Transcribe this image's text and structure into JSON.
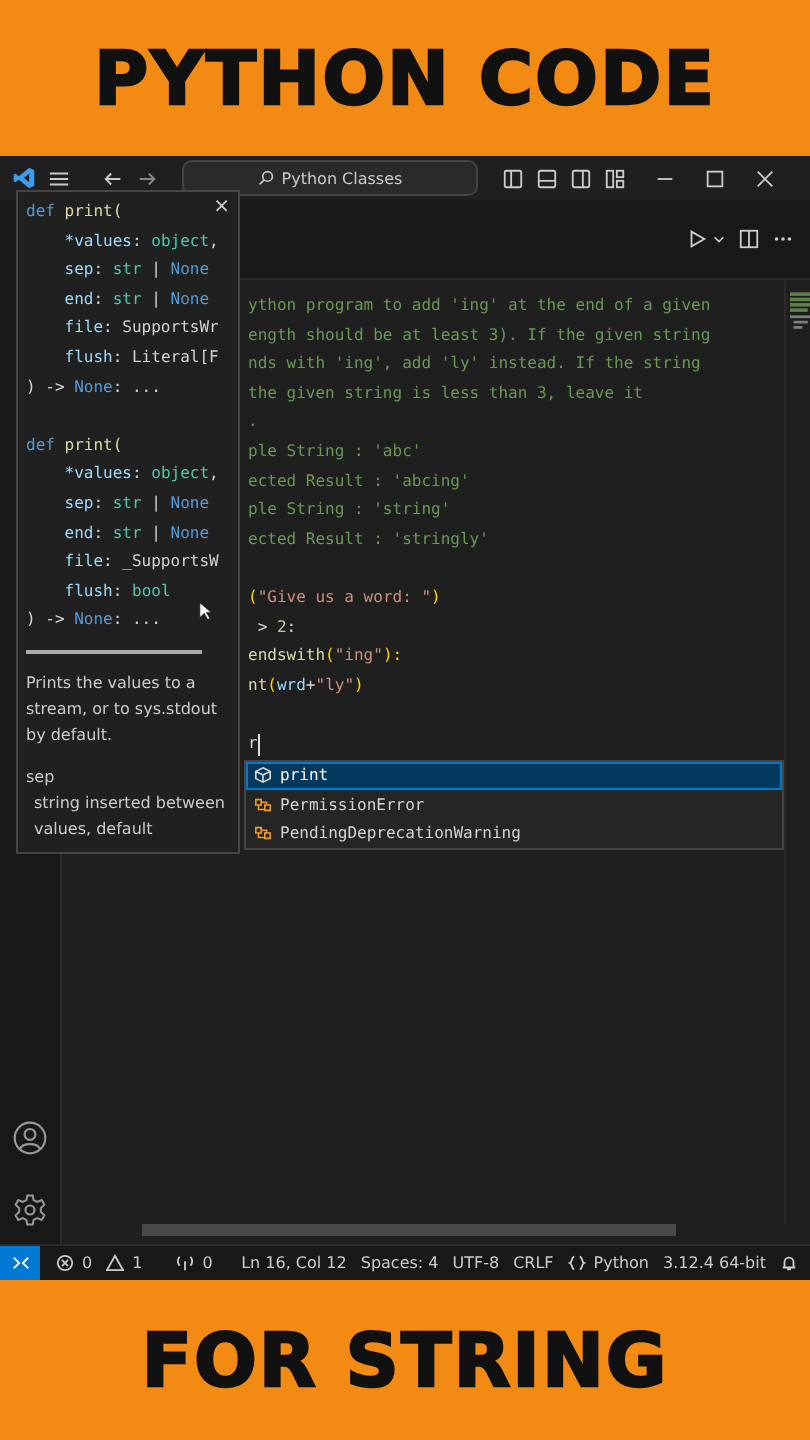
{
  "banner_top": "PYTHON CODE",
  "title_bar": {
    "search": "Python Classes"
  },
  "hover": {
    "close": "×",
    "signatures": [
      [
        [
          {
            "t": "def",
            "kind": "kw"
          },
          {
            "t": " print(",
            "kind": "fn"
          }
        ],
        [
          {
            "t": "    *values",
            "kind": "param"
          },
          {
            "t": ": ",
            "kind": "plain"
          },
          {
            "t": "object",
            "kind": "type"
          },
          {
            "t": ",",
            "kind": "plain"
          }
        ],
        [
          {
            "t": "    sep",
            "kind": "param"
          },
          {
            "t": ": ",
            "kind": "plain"
          },
          {
            "t": "str",
            "kind": "type"
          },
          {
            "t": " | ",
            "kind": "plain"
          },
          {
            "t": "None",
            "kind": "kw"
          }
        ],
        [
          {
            "t": "    end",
            "kind": "param"
          },
          {
            "t": ": ",
            "kind": "plain"
          },
          {
            "t": "str",
            "kind": "type"
          },
          {
            "t": " | ",
            "kind": "plain"
          },
          {
            "t": "None",
            "kind": "kw"
          }
        ],
        [
          {
            "t": "    file",
            "kind": "param"
          },
          {
            "t": ": SupportsWr",
            "kind": "plain"
          }
        ],
        [
          {
            "t": "    flush",
            "kind": "param"
          },
          {
            "t": ": Literal[F",
            "kind": "plain"
          }
        ],
        [
          {
            "t": ") -> ",
            "kind": "plain"
          },
          {
            "t": "None",
            "kind": "kw"
          },
          {
            "t": ": ...",
            "kind": "plain"
          }
        ]
      ],
      [
        [
          {
            "t": "def",
            "kind": "kw"
          },
          {
            "t": " print(",
            "kind": "fn"
          }
        ],
        [
          {
            "t": "    *values",
            "kind": "param"
          },
          {
            "t": ": ",
            "kind": "plain"
          },
          {
            "t": "object",
            "kind": "type"
          },
          {
            "t": ",",
            "kind": "plain"
          }
        ],
        [
          {
            "t": "    sep",
            "kind": "param"
          },
          {
            "t": ": ",
            "kind": "plain"
          },
          {
            "t": "str",
            "kind": "type"
          },
          {
            "t": " | ",
            "kind": "plain"
          },
          {
            "t": "None",
            "kind": "kw"
          }
        ],
        [
          {
            "t": "    end",
            "kind": "param"
          },
          {
            "t": ": ",
            "kind": "plain"
          },
          {
            "t": "str",
            "kind": "type"
          },
          {
            "t": " | ",
            "kind": "plain"
          },
          {
            "t": "None",
            "kind": "kw"
          }
        ],
        [
          {
            "t": "    file",
            "kind": "param"
          },
          {
            "t": ": _SupportsW",
            "kind": "plain"
          }
        ],
        [
          {
            "t": "    flush",
            "kind": "param"
          },
          {
            "t": ": ",
            "kind": "plain"
          },
          {
            "t": "bool",
            "kind": "type"
          }
        ],
        [
          {
            "t": ") -> ",
            "kind": "plain"
          },
          {
            "t": "None",
            "kind": "kw"
          },
          {
            "t": ": ...",
            "kind": "plain"
          }
        ]
      ]
    ],
    "description": "Prints the values to a stream, or to sys.stdout by default.",
    "param_name": "sep",
    "param_doc": "string inserted between values, default"
  },
  "code_lines": [
    {
      "tokens": [
        {
          "t": "ython program to add 'ing' at the end of a given",
          "kind": "comment"
        }
      ]
    },
    {
      "tokens": [
        {
          "t": "ength should be at least 3). If the given string",
          "kind": "comment"
        }
      ]
    },
    {
      "tokens": [
        {
          "t": "nds with 'ing', add 'ly' instead. If the string",
          "kind": "comment"
        }
      ]
    },
    {
      "tokens": [
        {
          "t": "the given string is less than 3, leave it",
          "kind": "comment"
        }
      ]
    },
    {
      "tokens": [
        {
          "t": ".",
          "kind": "comment"
        }
      ]
    },
    {
      "tokens": [
        {
          "t": "ple String : 'abc'",
          "kind": "comment"
        }
      ]
    },
    {
      "tokens": [
        {
          "t": "ected Result : 'abcing'",
          "kind": "comment"
        }
      ]
    },
    {
      "tokens": [
        {
          "t": "ple String : 'string'",
          "kind": "comment"
        }
      ]
    },
    {
      "tokens": [
        {
          "t": "ected Result : 'stringly'",
          "kind": "comment"
        }
      ]
    },
    {
      "gap_before": true,
      "tokens": [
        {
          "t": "(",
          "kind": "paren"
        },
        {
          "t": "\"Give us a word: \"",
          "kind": "str"
        },
        {
          "t": ")",
          "kind": "paren"
        }
      ]
    },
    {
      "tokens": [
        {
          "t": " > ",
          "kind": "plain"
        },
        {
          "t": "2",
          "kind": "num"
        },
        {
          "t": ":",
          "kind": "plain"
        }
      ]
    },
    {
      "tokens": [
        {
          "t": "endswith",
          "kind": "fn"
        },
        {
          "t": "(",
          "kind": "paren"
        },
        {
          "t": "\"ing\"",
          "kind": "str"
        },
        {
          "t": "):",
          "kind": "paren"
        }
      ]
    },
    {
      "tokens": [
        {
          "t": "nt",
          "kind": "fn"
        },
        {
          "t": "(",
          "kind": "paren"
        },
        {
          "t": "wrd",
          "kind": "param"
        },
        {
          "t": "+",
          "kind": "plain"
        },
        {
          "t": "\"ly\"",
          "kind": "str"
        },
        {
          "t": ")",
          "kind": "paren"
        }
      ]
    },
    {
      "gap_before": true,
      "tokens": [
        {
          "t": "r",
          "kind": "plain"
        }
      ]
    }
  ],
  "suggestions": [
    {
      "label": "print",
      "kind": "function",
      "selected": true
    },
    {
      "label": "PermissionError",
      "kind": "class",
      "selected": false
    },
    {
      "label": "PendingDeprecationWarning",
      "kind": "class",
      "selected": false
    }
  ],
  "status_bar": {
    "errors": "0",
    "warnings": "1",
    "ports": "0",
    "position": "Ln 16, Col 12",
    "spaces": "Spaces: 4",
    "encoding": "UTF-8",
    "eol": "CRLF",
    "language": "Python",
    "interpreter": "3.12.4 64-bit"
  },
  "banner_bottom": "FOR STRING"
}
